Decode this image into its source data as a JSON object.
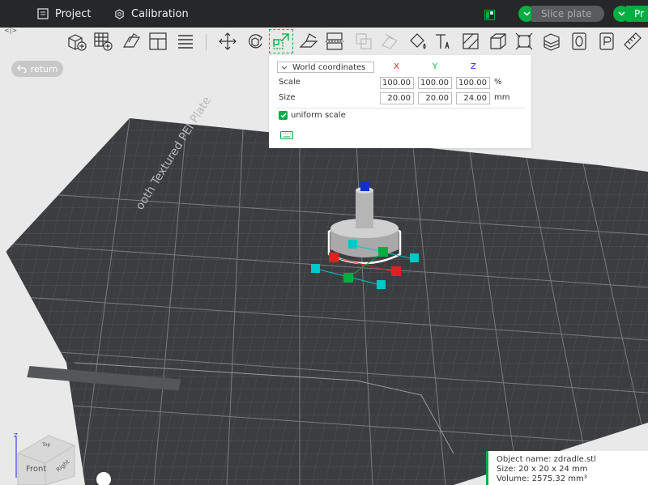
{
  "titlebar": {
    "project_label": "Project",
    "calibration_label": "Calibration",
    "slice_label": "Slice plate",
    "print_label": "Pr"
  },
  "toolbar": {
    "tools": [
      "add-object",
      "add-plate",
      "auto-orient",
      "arrange",
      "split-parts",
      "move",
      "rotate",
      "scale",
      "lay-on-face",
      "cut",
      "boolean",
      "support-paint",
      "seam-paint",
      "fuzzy-paint",
      "text",
      "measure-shape",
      "assembly",
      "cube-object",
      "plate-settings",
      "variable-layer",
      "brim",
      "per-object",
      "ruler"
    ]
  },
  "viewport": {
    "return_label": "return",
    "plate_text": "ooth Textured PEI Plate",
    "front_label": "Front",
    "right_label": "Right",
    "top_label": "Top"
  },
  "scale_panel": {
    "coord_mode": "World coordinates",
    "axes": [
      "X",
      "Y",
      "Z"
    ],
    "scale_label": "Scale",
    "size_label": "Size",
    "scale_values": [
      "100.00",
      "100.00",
      "100.00"
    ],
    "size_values": [
      "20.00",
      "20.00",
      "24.00"
    ],
    "scale_unit": "%",
    "size_unit": "mm",
    "uniform_label": "uniform scale",
    "uniform_checked": true
  },
  "object_info": {
    "name_line": "Object name: zdradle.stl",
    "size_line": "Size: 20 x 20 x 24 mm",
    "volume_line": "Volume: 2575.32 mm³"
  },
  "colors": {
    "accent": "#00ae42",
    "titlebar": "#262729",
    "bed": "#3c3d40",
    "background": "#e9e9e9",
    "axis_x": "#e02020",
    "axis_y": "#00ae42",
    "axis_z": "#2020e0"
  }
}
